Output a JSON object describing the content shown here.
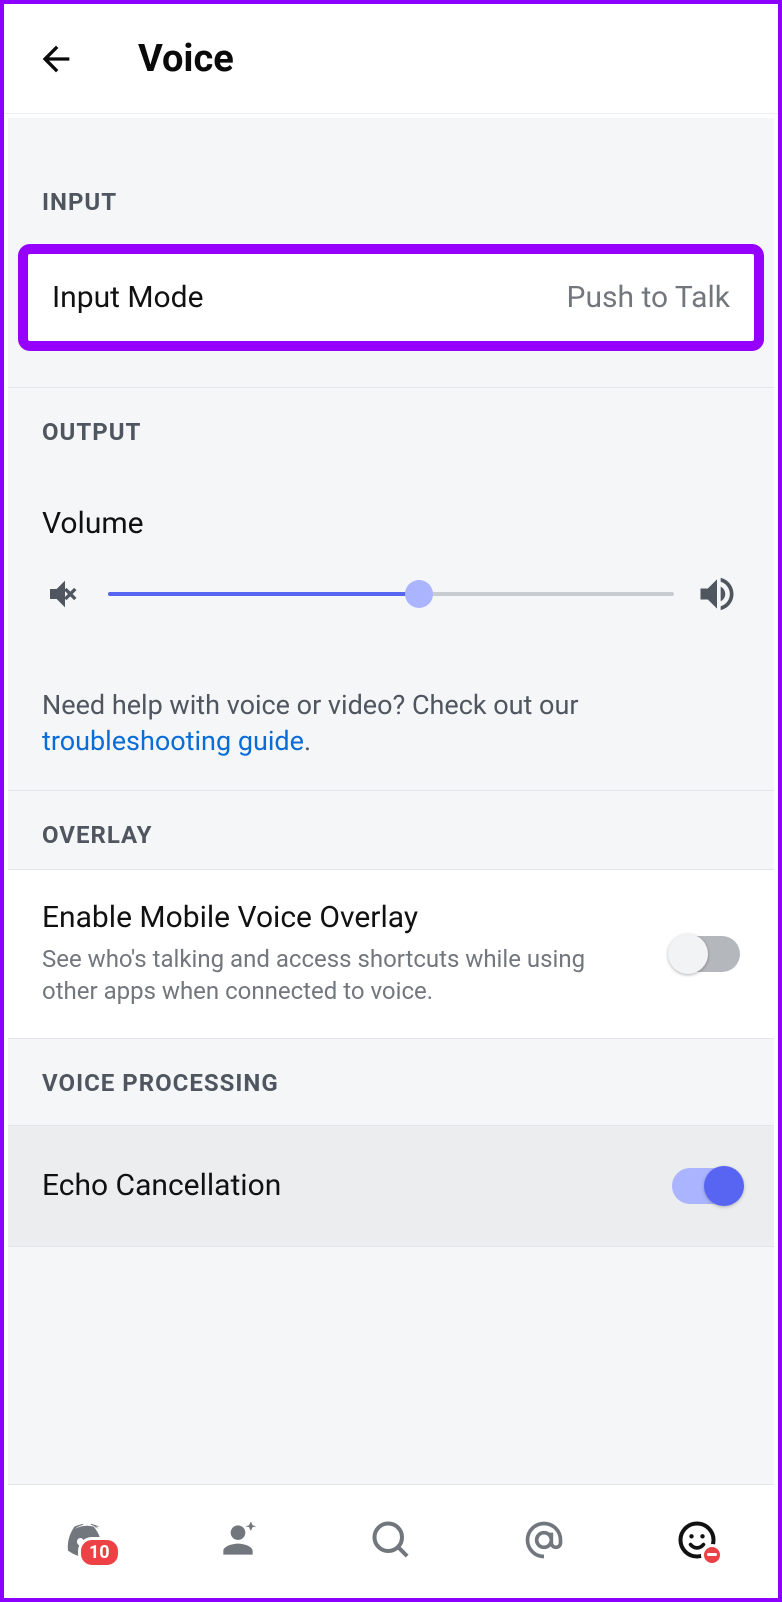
{
  "header": {
    "title": "Voice"
  },
  "sections": {
    "input": {
      "heading": "INPUT",
      "input_mode_label": "Input Mode",
      "input_mode_value": "Push to Talk"
    },
    "output": {
      "heading": "OUTPUT",
      "volume_label": "Volume",
      "volume_percent": 55,
      "help_text": "Need help with voice or video? Check out our ",
      "help_link": "troubleshooting guide",
      "help_suffix": "."
    },
    "overlay": {
      "heading": "OVERLAY",
      "toggle_label": "Enable Mobile Voice Overlay",
      "toggle_desc": "See who's talking and access shortcuts while using other apps when connected to voice.",
      "toggle_on": false
    },
    "voice_processing": {
      "heading": "VOICE PROCESSING",
      "echo_label": "Echo Cancellation",
      "echo_on": true
    }
  },
  "nav": {
    "badge_count": "10"
  }
}
